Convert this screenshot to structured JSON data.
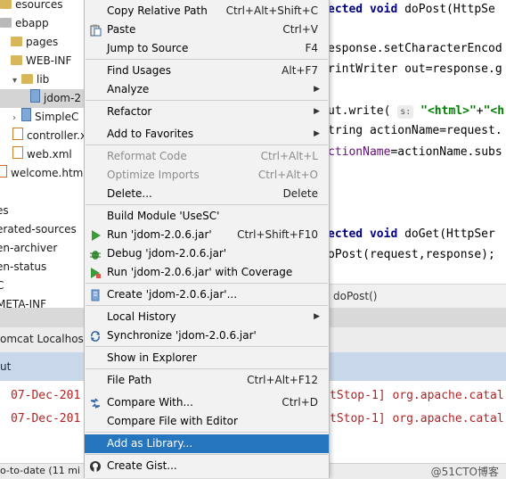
{
  "project_tree": {
    "rows": [
      {
        "label": "esources",
        "type": "folder"
      },
      {
        "label": "ebapp",
        "type": "folder"
      },
      {
        "label": "pages",
        "type": "folder"
      },
      {
        "label": "WEB-INF",
        "type": "folder"
      },
      {
        "label": "lib",
        "type": "folder"
      },
      {
        "label": "jdom-2",
        "type": "jar"
      },
      {
        "label": "SimpleC",
        "type": "jar"
      },
      {
        "label": "controller.x",
        "type": "xml"
      },
      {
        "label": "web.xml",
        "type": "xml"
      },
      {
        "label": "welcome.html",
        "type": "html"
      },
      {
        "label": "es",
        "type": "text"
      },
      {
        "label": "erated-sources",
        "type": "text"
      },
      {
        "label": "en-archiver",
        "type": "text"
      },
      {
        "label": "en-status",
        "type": "text"
      },
      {
        "label": "C",
        "type": "text"
      },
      {
        "label": "META-INF",
        "type": "text"
      }
    ]
  },
  "editor": {
    "lines": [
      {
        "parts": [
          {
            "t": "ected void ",
            "c": "kw"
          },
          {
            "t": "doPost(HttpSe",
            "c": ""
          }
        ]
      },
      {
        "parts": [
          {
            "t": "esponse.setCharacterEncod",
            "c": ""
          }
        ]
      },
      {
        "parts": [
          {
            "t": "rintWriter out=response.g",
            "c": ""
          }
        ]
      },
      {
        "parts": [
          {
            "t": "ut.write( ",
            "c": ""
          },
          {
            "t": "s:",
            "c": "hint"
          },
          {
            "t": " \"<html>\"",
            "c": "str"
          },
          {
            "t": "+",
            "c": ""
          },
          {
            "t": "\"<h",
            "c": "str"
          }
        ]
      },
      {
        "parts": [
          {
            "t": "tring actionName=request.",
            "c": ""
          }
        ]
      },
      {
        "parts": [
          {
            "t": "ctionName",
            "c": "field"
          },
          {
            "t": "=actionName.subs",
            "c": ""
          }
        ]
      },
      {
        "parts": [
          {
            "t": "ected void ",
            "c": "kw"
          },
          {
            "t": "doGet(HttpSer",
            "c": ""
          }
        ]
      },
      {
        "parts": [
          {
            "t": "oPost(request,response);",
            "c": ""
          }
        ]
      }
    ],
    "breadcrumb": "doPost()"
  },
  "run_window": {
    "tab_left": "omcat Localhost L",
    "sub_label": "ut",
    "log_left": [
      "07-Dec-201",
      "07-Dec-201"
    ],
    "log_right": [
      "tStop-1] org.apache.catal",
      "tStop-1] org.apache.catal"
    ]
  },
  "status_bar": {
    "text": "o-to-date (11 mi",
    "watermark": "@51CTO博客"
  },
  "context_menu": {
    "items": [
      {
        "label": "Copy Relative Path",
        "shortcut": "Ctrl+Alt+Shift+C",
        "icon": ""
      },
      {
        "label": "Paste",
        "shortcut": "Ctrl+V",
        "icon": "paste-icon"
      },
      {
        "label": "Jump to Source",
        "shortcut": "F4",
        "icon": ""
      },
      {
        "label": "Find Usages",
        "shortcut": "Alt+F7",
        "icon": ""
      },
      {
        "label": "Analyze",
        "shortcut": "",
        "icon": "",
        "submenu": true
      },
      {
        "label": "Refactor",
        "shortcut": "",
        "icon": "",
        "submenu": true
      },
      {
        "label": "Add to Favorites",
        "shortcut": "",
        "icon": "",
        "submenu": true
      },
      {
        "label": "Reformat Code",
        "shortcut": "Ctrl+Alt+L",
        "icon": "",
        "disabled": true
      },
      {
        "label": "Optimize Imports",
        "shortcut": "Ctrl+Alt+O",
        "icon": "",
        "disabled": true
      },
      {
        "label": "Delete...",
        "shortcut": "Delete",
        "icon": ""
      },
      {
        "label": "Build Module 'UseSC'",
        "shortcut": "",
        "icon": ""
      },
      {
        "label": "Run 'jdom-2.0.6.jar'",
        "shortcut": "Ctrl+Shift+F10",
        "icon": "run-icon"
      },
      {
        "label": "Debug 'jdom-2.0.6.jar'",
        "shortcut": "",
        "icon": "debug-icon"
      },
      {
        "label": "Run 'jdom-2.0.6.jar' with Coverage",
        "shortcut": "",
        "icon": "coverage-icon"
      },
      {
        "label": "Create 'jdom-2.0.6.jar'...",
        "shortcut": "",
        "icon": "create-icon"
      },
      {
        "label": "Local History",
        "shortcut": "",
        "icon": "",
        "submenu": true
      },
      {
        "label": "Synchronize 'jdom-2.0.6.jar'",
        "shortcut": "",
        "icon": "sync-icon"
      },
      {
        "label": "Show in Explorer",
        "shortcut": "",
        "icon": ""
      },
      {
        "label": "File Path",
        "shortcut": "Ctrl+Alt+F12",
        "icon": ""
      },
      {
        "label": "Compare With...",
        "shortcut": "Ctrl+D",
        "icon": "compare-icon"
      },
      {
        "label": "Compare File with Editor",
        "shortcut": "",
        "icon": ""
      },
      {
        "label": "Add as Library...",
        "shortcut": "",
        "icon": "",
        "selected": true
      },
      {
        "label": "Create Gist...",
        "shortcut": "",
        "icon": "github-icon"
      }
    ]
  },
  "colors": {
    "menu_selection": "#2675bf",
    "keyword": "#000080",
    "string": "#008000",
    "log_text": "#b22222"
  }
}
